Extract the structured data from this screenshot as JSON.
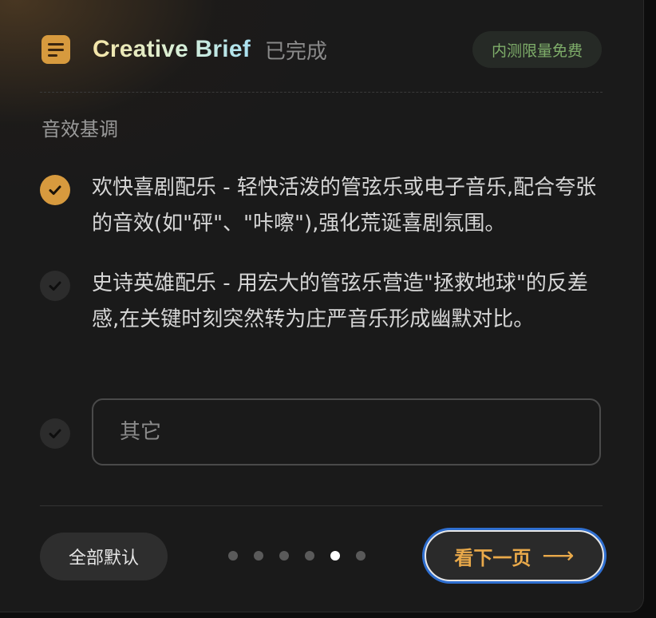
{
  "header": {
    "title": "Creative Brief",
    "status": "已完成",
    "badge": "内测限量免费"
  },
  "section": {
    "label": "音效基调"
  },
  "options": [
    {
      "text": "欢快喜剧配乐 - 轻快活泼的管弦乐或电子音乐,配合夸张的音效(如\"砰\"、\"咔嚓\"),强化荒诞喜剧氛围。",
      "selected": true
    },
    {
      "text": "史诗英雄配乐 - 用宏大的管弦乐营造\"拯救地球\"的反差感,在关键时刻突然转为庄严音乐形成幽默对比。",
      "selected": false
    }
  ],
  "other": {
    "placeholder": "其它",
    "value": ""
  },
  "footer": {
    "default_label": "全部默认",
    "next_label": "看下一页",
    "pagination": {
      "total": 6,
      "current": 5
    }
  },
  "colors": {
    "accent": "#d79a3e",
    "badge_text": "#7fae6a",
    "focus_ring": "#2f6fd0"
  },
  "icons": {
    "doc": "document-icon",
    "check": "checkmark-icon",
    "arrow": "arrow-right-icon"
  }
}
